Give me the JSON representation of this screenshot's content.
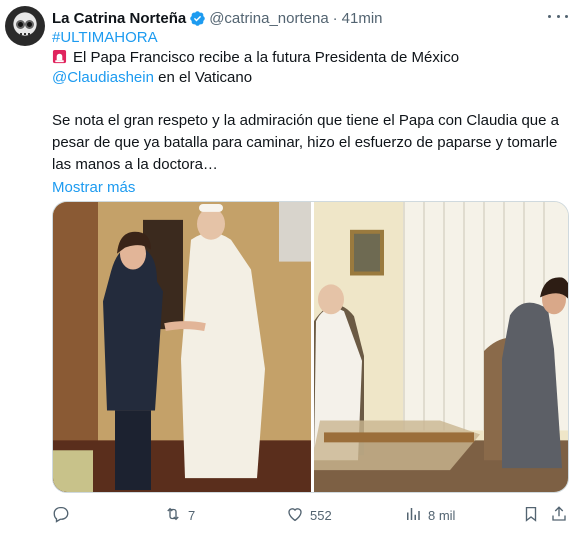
{
  "author": {
    "display_name": "La Catrina Norteña",
    "handle": "@catrina_nortena",
    "separator": "·",
    "time": "41min"
  },
  "tweet": {
    "hashtag": "#ULTIMAHORA",
    "line2_text": "El Papa Francisco recibe a la futura Presidenta de México",
    "mention": "@Claudiashein",
    "line3_text": " en el Vaticano",
    "para2_lines": [
      "Se nota el gran respeto y la admiración que tiene el Papa con Claudia que a",
      "pesar de que ya batalla para caminar, hizo el esfuerzo de paparse y tomarle",
      "las manos a la doctora…"
    ],
    "show_more": "Mostrar más"
  },
  "actions": {
    "reply_count": "",
    "retweet_count": "7",
    "like_count": "552",
    "views_count": "8 mil"
  },
  "icons": {
    "verified": "verified-badge-icon",
    "siren": "rotating-light-icon",
    "more": "more-options-icon",
    "reply": "reply-icon",
    "retweet": "retweet-icon",
    "like": "heart-icon",
    "views": "views-chart-icon",
    "bookmark": "bookmark-icon",
    "share": "share-icon"
  },
  "colors": {
    "link": "#1d9bf0",
    "secondary_text": "#536471",
    "primary_text": "#0f1419",
    "siren_red": "#e0245e"
  }
}
